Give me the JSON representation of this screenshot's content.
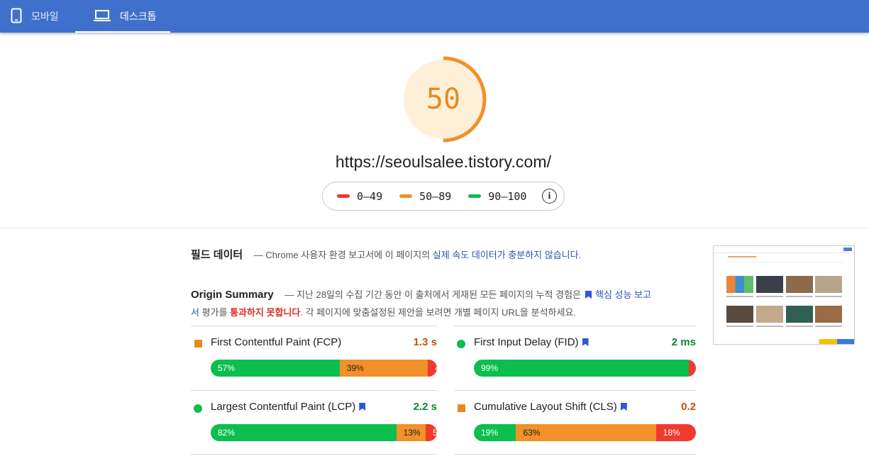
{
  "tabs": [
    {
      "label": "모바일",
      "icon": "phone-icon",
      "active": false
    },
    {
      "label": "데스크톱",
      "icon": "laptop-icon",
      "active": true
    }
  ],
  "score": {
    "value": "50",
    "fraction": 0.5,
    "color": "#e8891d"
  },
  "url": "https://seoulsalee.tistory.com/",
  "legend": [
    {
      "label": "0–49",
      "color": "#f03a2e"
    },
    {
      "label": "50–89",
      "color": "#f2902a"
    },
    {
      "label": "90–100",
      "color": "#0cbe4e"
    }
  ],
  "field_data": {
    "title": "필드 데이터",
    "dash": "—",
    "text_before": "Chrome 사용자 환경 보고서에 이 페이지의 ",
    "link": "실제 속도 데이터가 충분하지 않습니다."
  },
  "origin": {
    "title": "Origin Summary",
    "dash": "—",
    "text1": "지난 28일의 수집 기간 동안 이 출처에서 게재된 모든 페이지의 누적 경험은",
    "link": "핵심 성능 보고서",
    "text2": " 평가를 ",
    "fail": "통과하지 못합니다",
    "text3": ". 각 페이지에 맞춤설정된 제안을 보려면 개별 페이지 URL을 분석하세요."
  },
  "metrics": [
    {
      "name": "First Contentful Paint (FCP)",
      "value": "1.3 s",
      "status": "orange",
      "bookmark": false,
      "dist": [
        {
          "label": "57%",
          "pct": 57
        },
        {
          "label": "39%",
          "pct": 39
        },
        {
          "label": "4%",
          "pct": 4
        }
      ]
    },
    {
      "name": "First Input Delay (FID)",
      "value": "2 ms",
      "status": "green",
      "bookmark": true,
      "dist": [
        {
          "label": "99%",
          "pct": 99
        },
        {
          "label": "",
          "pct": 0
        },
        {
          "label": "",
          "pct": 1
        }
      ]
    },
    {
      "name": "Largest Contentful Paint (LCP)",
      "value": "2.2 s",
      "status": "green",
      "bookmark": true,
      "dist": [
        {
          "label": "82%",
          "pct": 82
        },
        {
          "label": "13%",
          "pct": 13
        },
        {
          "label": "5%",
          "pct": 5
        }
      ]
    },
    {
      "name": "Cumulative Layout Shift (CLS)",
      "value": "0.2",
      "status": "orange",
      "bookmark": true,
      "dist": [
        {
          "label": "19%",
          "pct": 19
        },
        {
          "label": "63%",
          "pct": 63
        },
        {
          "label": "18%",
          "pct": 18
        }
      ]
    }
  ],
  "thumbnail": {
    "name": "page-screenshot",
    "text": "마리에 관한 문제들"
  }
}
